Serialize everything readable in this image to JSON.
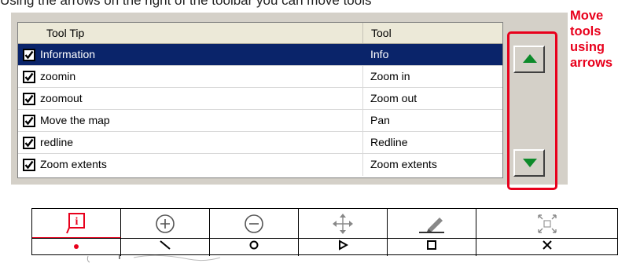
{
  "top_text": "Using the arrows on the right of the toolbar you can move tools",
  "grid": {
    "headers": [
      "Tool Tip",
      "Tool"
    ],
    "rows": [
      {
        "tip": "Information",
        "tool": "Info",
        "checked": true,
        "selected": true
      },
      {
        "tip": "zoomin",
        "tool": "Zoom in",
        "checked": true,
        "selected": false
      },
      {
        "tip": "zoomout",
        "tool": "Zoom out",
        "checked": true,
        "selected": false
      },
      {
        "tip": "Move the map",
        "tool": "Pan",
        "checked": true,
        "selected": false
      },
      {
        "tip": "redline",
        "tool": "Redline",
        "checked": true,
        "selected": false
      },
      {
        "tip": "Zoom extents",
        "tool": "Zoom extents",
        "checked": true,
        "selected": false
      }
    ]
  },
  "buttons": {
    "move_up_icon": "triangle-up-icon",
    "move_down_icon": "triangle-down-icon",
    "arrow_color": "#0d8a2a"
  },
  "note": {
    "lines": [
      "Move",
      "tools",
      "using",
      "arrows"
    ],
    "color": "#e8001c"
  },
  "toolbar": {
    "icons": [
      "info-icon",
      "zoom-in-icon",
      "zoom-out-icon",
      "pan-icon",
      "redline-icon",
      "zoom-extents-icon"
    ],
    "glyphs": [
      "•",
      "\\",
      "o",
      "ᐅ",
      "□",
      "✕"
    ]
  }
}
